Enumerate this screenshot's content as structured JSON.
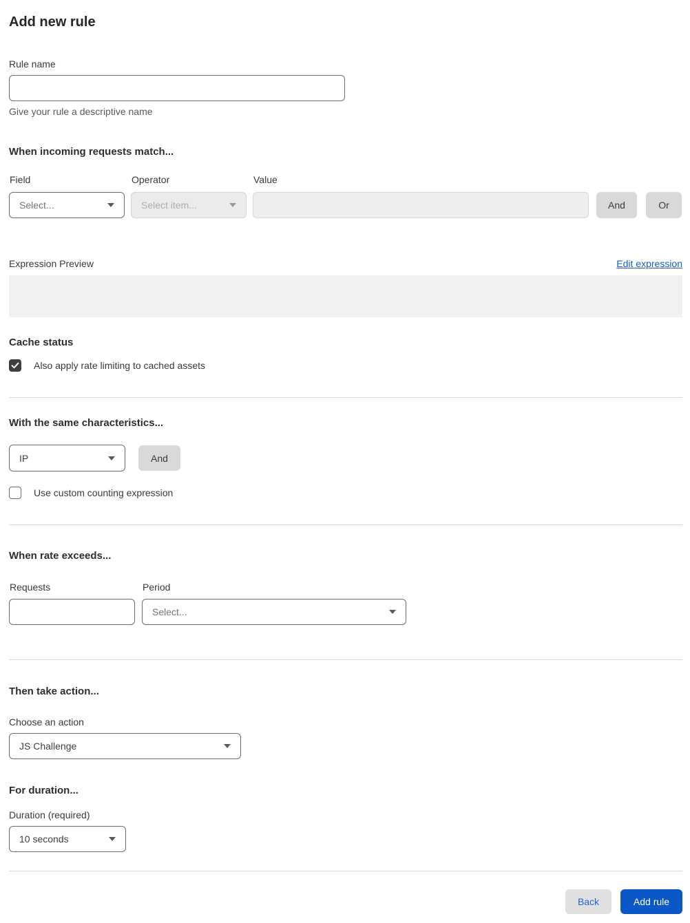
{
  "page": {
    "title": "Add new rule"
  },
  "rule_name": {
    "label": "Rule name",
    "value": "",
    "helper": "Give your rule a descriptive name"
  },
  "match": {
    "heading": "When incoming requests match...",
    "field_label": "Field",
    "field_value": "Select...",
    "operator_label": "Operator",
    "operator_value": "Select item...",
    "value_label": "Value",
    "value_text": "",
    "and_label": "And",
    "or_label": "Or"
  },
  "expression": {
    "label": "Expression Preview",
    "edit_link": "Edit expression",
    "preview_text": ""
  },
  "cache": {
    "heading": "Cache status",
    "checkbox_label": "Also apply rate limiting to cached assets",
    "checked": true
  },
  "characteristics": {
    "heading": "With the same characteristics...",
    "select_value": "IP",
    "and_label": "And",
    "checkbox_label": "Use custom counting expression",
    "checked": false
  },
  "rate": {
    "heading": "When rate exceeds...",
    "requests_label": "Requests",
    "requests_value": "",
    "period_label": "Period",
    "period_value": "Select..."
  },
  "action": {
    "heading": "Then take action...",
    "label": "Choose an action",
    "value": "JS Challenge"
  },
  "duration": {
    "heading": "For duration...",
    "label": "Duration (required)",
    "value": "10 seconds"
  },
  "footer": {
    "back_label": "Back",
    "submit_label": "Add rule"
  },
  "icons": {
    "select_chevron": "chevron-down-icon",
    "checked_mark": "check-icon"
  },
  "colors": {
    "primary_button_blue": "#0b57c7",
    "link_blue": "#1b5dc8",
    "back_text_blue": "#2563c9",
    "checkbox_checked_dark": "#3d3f3f",
    "disabled_field_bg": "#ebebeb",
    "expression_preview_bg": "#f1f1f1",
    "gray_button_bg": "#d9d9d9",
    "divider_gray": "#d9d9d9",
    "helper_text_gray": "#595959"
  }
}
